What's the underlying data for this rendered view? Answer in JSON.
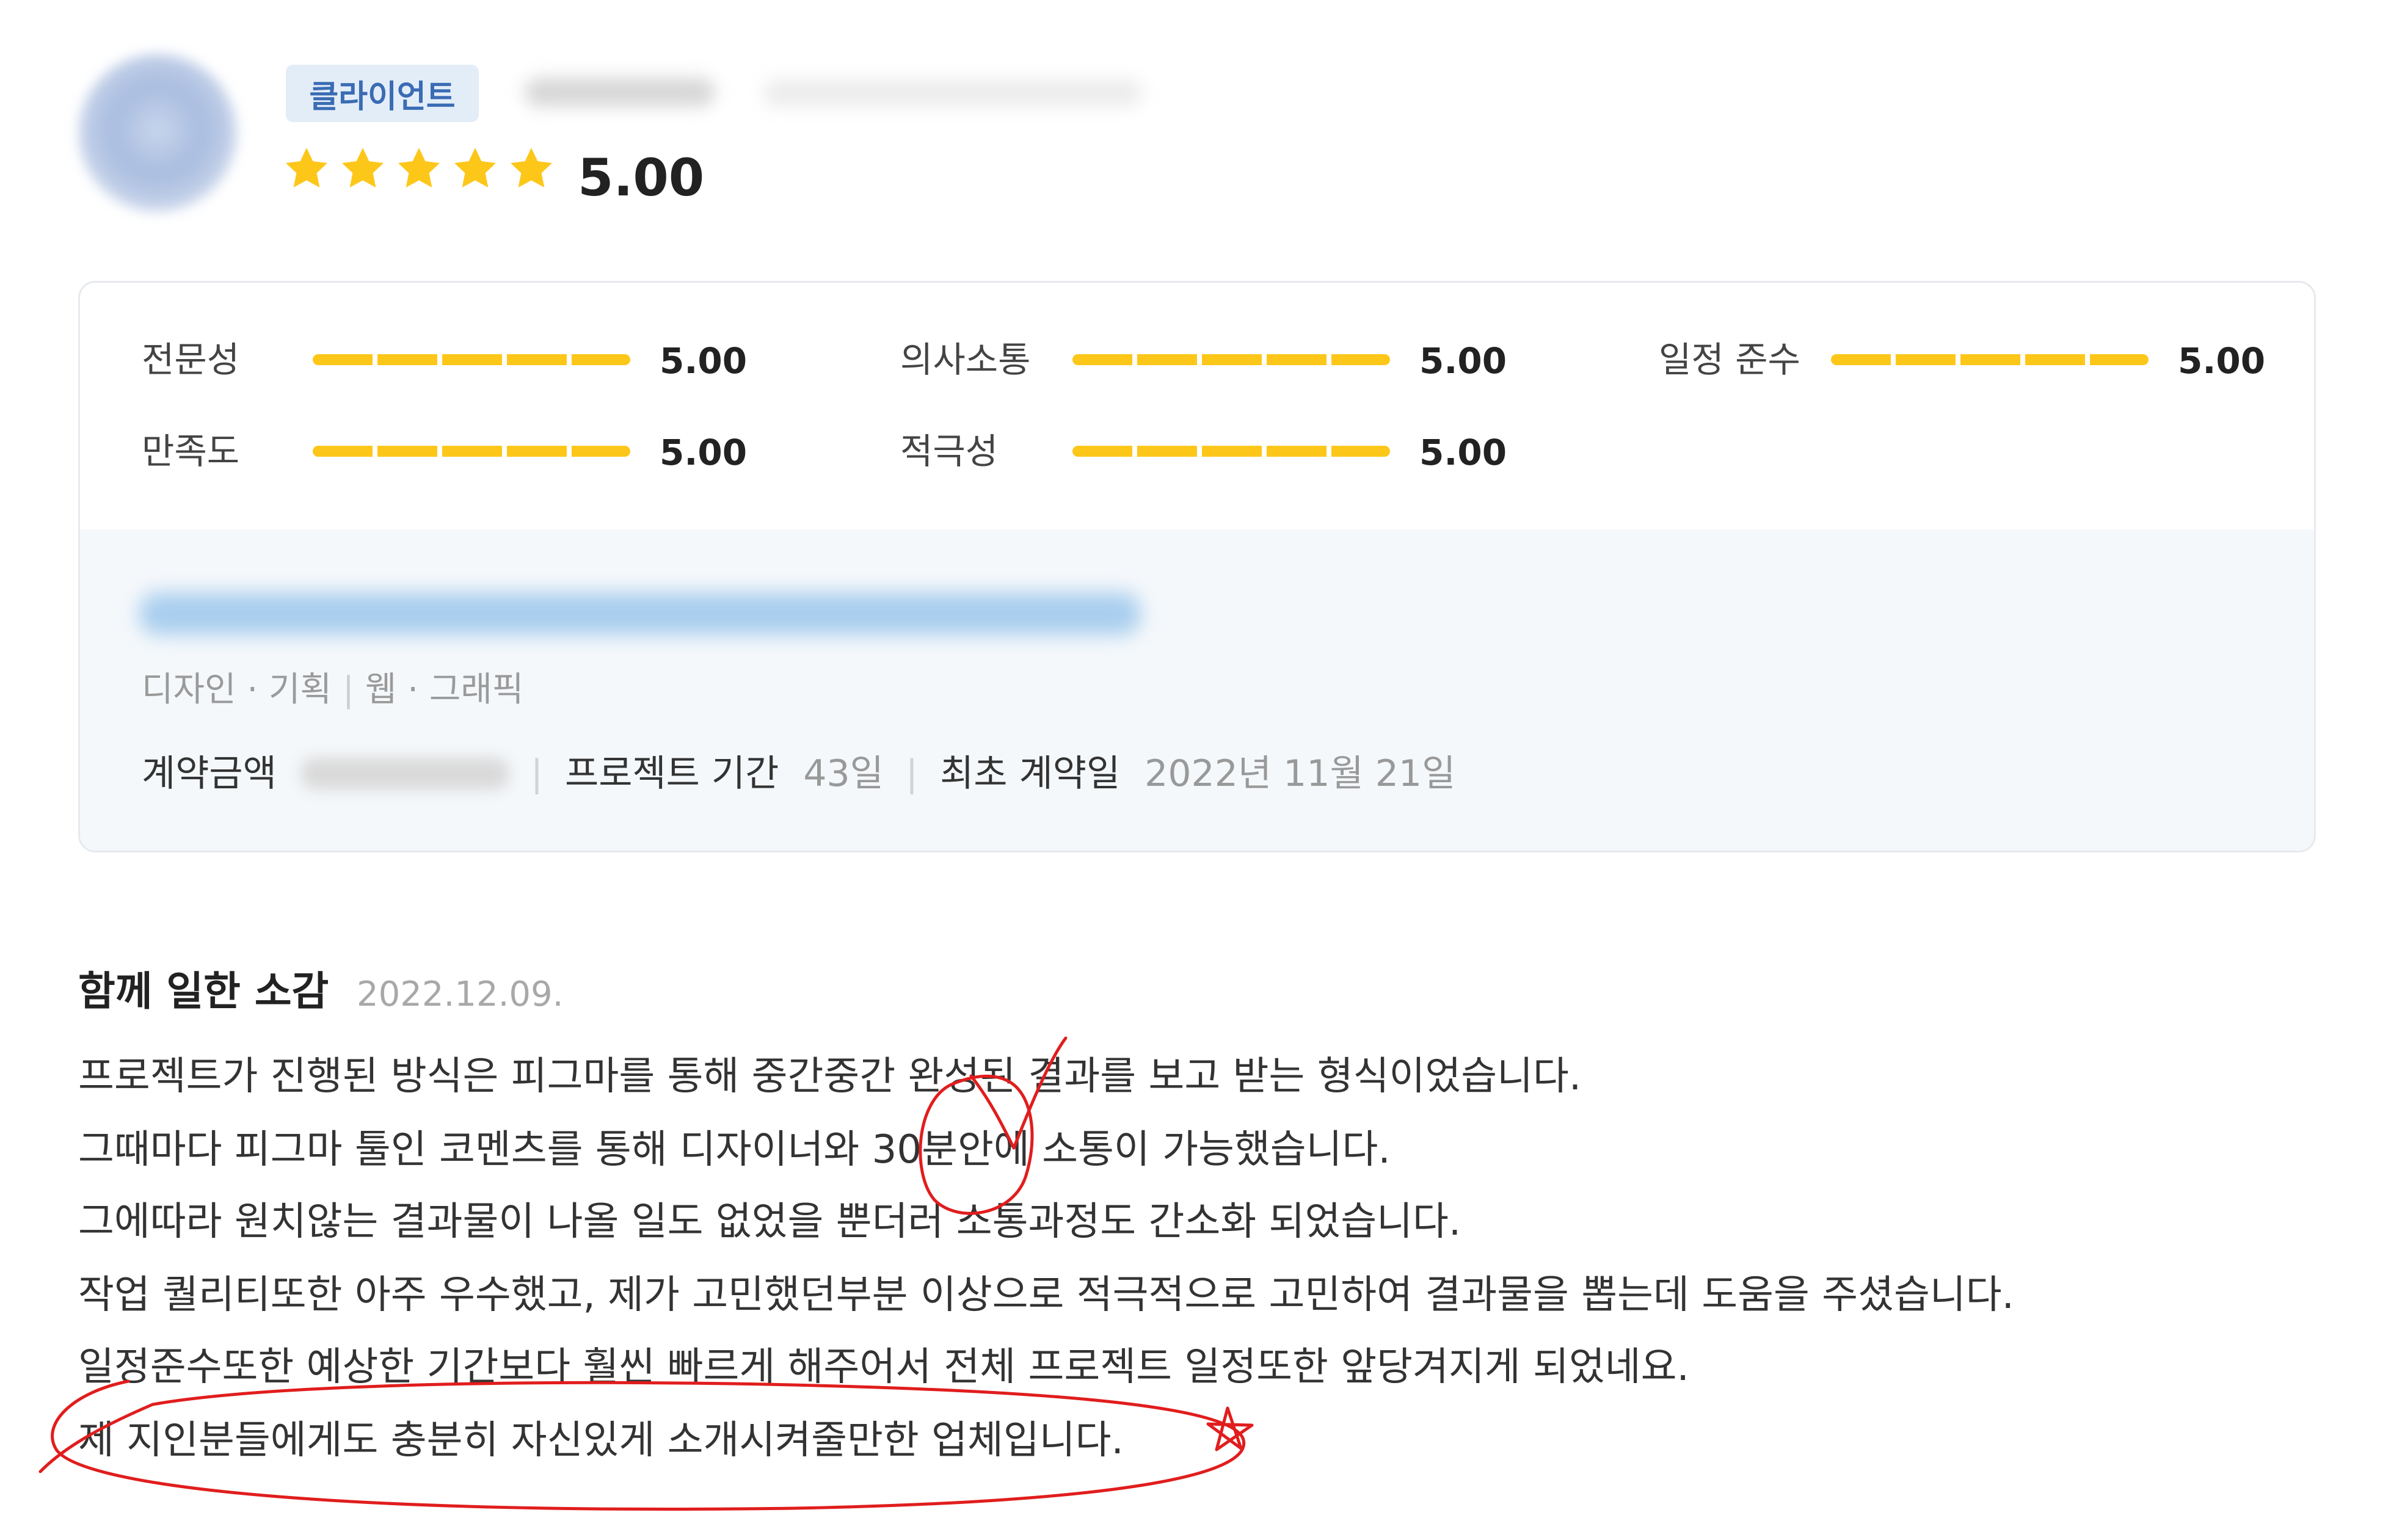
{
  "header": {
    "badge": "클라이언트",
    "rating_value": 5.0,
    "rating_text": "5.00",
    "star_count": 5,
    "star_color": "#fdc71a"
  },
  "criteria": [
    {
      "label": "전문성",
      "value": "5.00"
    },
    {
      "label": "의사소통",
      "value": "5.00"
    },
    {
      "label": "일정 준수",
      "value": "5.00"
    },
    {
      "label": "만족도",
      "value": "5.00"
    },
    {
      "label": "적극성",
      "value": "5.00"
    }
  ],
  "project": {
    "category": "디자인 · 기획",
    "subcategory": "웹 · 그래픽",
    "amount_label": "계약금액",
    "period_label": "프로젝트 기간",
    "period_value": "43일",
    "first_contract_label": "최초 계약일",
    "first_contract_value": "2022년 11월 21일"
  },
  "review": {
    "title": "함께 일한 소감",
    "date": "2022.12.09.",
    "lines": [
      "프로젝트가 진행된 방식은 피그마를 통해 중간중간 완성된 결과를 보고 받는 형식이었습니다.",
      "그때마다 피그마 툴인 코멘츠를 통해 디자이너와 30분안에 소통이 가능했습니다.",
      "그에따라 원치않는 결과물이 나올 일도 없었을 뿐더러 소통과정도 간소화 되었습니다.",
      "작업 퀄리티또한 아주 우수했고, 제가 고민했던부분 이상으로 적극적으로 고민하여 결과물을 뽑는데 도움을 주셨습니다.",
      "일정준수또한 예상한 기간보다 훨씬 빠르게 해주어서 전체 프로젝트 일정또한 앞당겨지게 되었네요.",
      "제 지인분들에게도 충분히 자신있게 소개시켜줄만한 업체입니다."
    ]
  },
  "colors": {
    "accent_yellow": "#fdc71a",
    "badge_bg": "#e3edf8",
    "badge_text": "#3a6cb4",
    "annotation_red": "#e11d1d"
  }
}
